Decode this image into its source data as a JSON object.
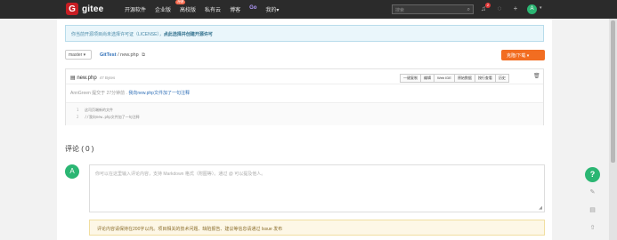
{
  "nav": {
    "brand": "gitee",
    "items": [
      "开源软件",
      "企业版",
      "高校版",
      "私有云",
      "博客",
      "Go",
      "我的▾"
    ],
    "hot_badge": "特惠",
    "search_placeholder": "搜索",
    "notification_count": "2",
    "user_initial": "A"
  },
  "license_notice": {
    "text": "你当前开源项目尚未选择许可证（LICENSE），",
    "link": "点此选择并创建开源许可"
  },
  "repo": {
    "branch": "master ▾",
    "owner_repo": "GitTest",
    "separator": "/",
    "file": "new.php",
    "clone_label": "克隆/下载 ▾"
  },
  "file": {
    "name": "new.php",
    "size": "47 Bytes",
    "actions": [
      "一键复制",
      "编辑",
      "Web IDE",
      "原始数据",
      "按行查看",
      "历史"
    ],
    "commit_prefix": "AnnGreen 提交于 27分钟前 .",
    "commit_message": "我向new.php文件加了一句注释",
    "code_lines": [
      {
        "no": "1",
        "text": "这司页端新的文件"
      },
      {
        "no": "2",
        "text": "//我向new.php文件加了一句注释"
      }
    ]
  },
  "comments": {
    "title": "评论 ( 0 )",
    "avatar_initial": "A",
    "placeholder": "你可以在这里输入评论内容，支持 Markdown 格式（附图等）。通过 @ 可以提及他人。",
    "notice": "评论内容请保持在200字以内。项目相关的技术问题、缺陷报告、建议等信息请通过 Issue 发布"
  },
  "help_label": "?"
}
